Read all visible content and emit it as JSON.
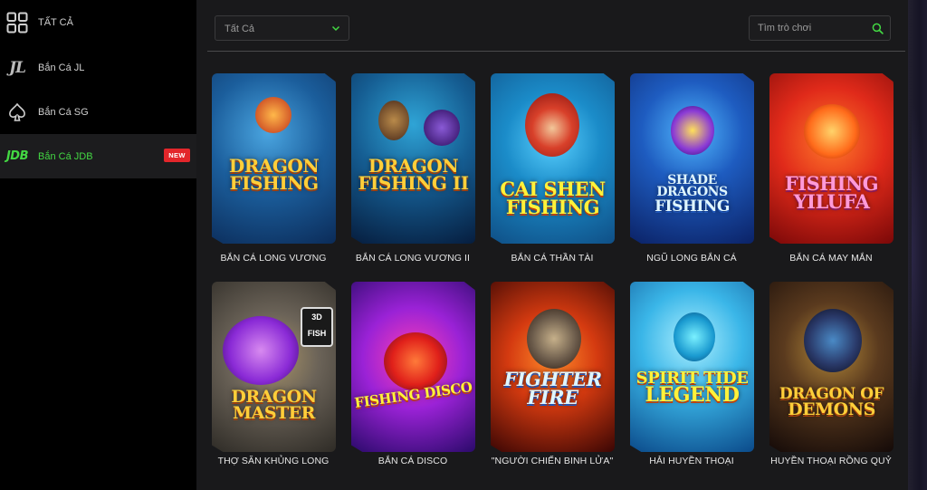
{
  "sidebar": {
    "items": [
      {
        "label": "TẤT CẢ",
        "icon": "grid-icon"
      },
      {
        "label": "Bắn Cá JL",
        "icon": "jl-logo-icon",
        "icon_text": "JL"
      },
      {
        "label": "Bắn Cá SG",
        "icon": "spade-icon"
      },
      {
        "label": "Bắn Cá JDB",
        "icon": "jdb-logo-icon",
        "icon_text": "JDB",
        "badge": "NEW",
        "active": true
      }
    ]
  },
  "filter": {
    "value": "Tất Cả"
  },
  "search": {
    "placeholder": "Tìm trò chơi"
  },
  "games": [
    {
      "name": "BẮN CÁ LONG VƯƠNG",
      "logo": [
        "DRAGON",
        "FISHING"
      ]
    },
    {
      "name": "BẮN CÁ LONG VƯƠNG II",
      "logo": [
        "DRAGON",
        "FISHING II"
      ]
    },
    {
      "name": "BẮN CÁ THẦN TÀI",
      "logo": [
        "CAI SHEN",
        "FISHING"
      ]
    },
    {
      "name": "NGŨ LONG BẮN CÁ",
      "logo": [
        "SHADE DRAGONS",
        "FISHING"
      ]
    },
    {
      "name": "BẮN CÁ MAY MẮN",
      "logo": [
        "FISHING",
        "YILUFA"
      ]
    },
    {
      "name": "THỢ SĂN KHỦNG LONG",
      "logo": [
        "DRAGON",
        "MASTER"
      ],
      "badge": "3D FISH"
    },
    {
      "name": "BẮN CÁ DISCO",
      "logo": [
        "FISHING DISCO"
      ]
    },
    {
      "name": "\"NGƯỜI CHIẾN BINH LỬA\"",
      "logo": [
        "FIGHTER",
        "FIRE"
      ]
    },
    {
      "name": "HẢI HUYỀN THOẠI",
      "logo": [
        "SPIRIT TIDE",
        "LEGEND"
      ]
    },
    {
      "name": "HUYỀN THOẠI RỒNG QUỶ",
      "logo": [
        "DRAGON OF",
        "DEMONS"
      ]
    }
  ],
  "colors": {
    "accent": "#43d843",
    "badge": "#e3262b",
    "sidebar_bg": "#000000",
    "main_bg": "#19191b"
  }
}
